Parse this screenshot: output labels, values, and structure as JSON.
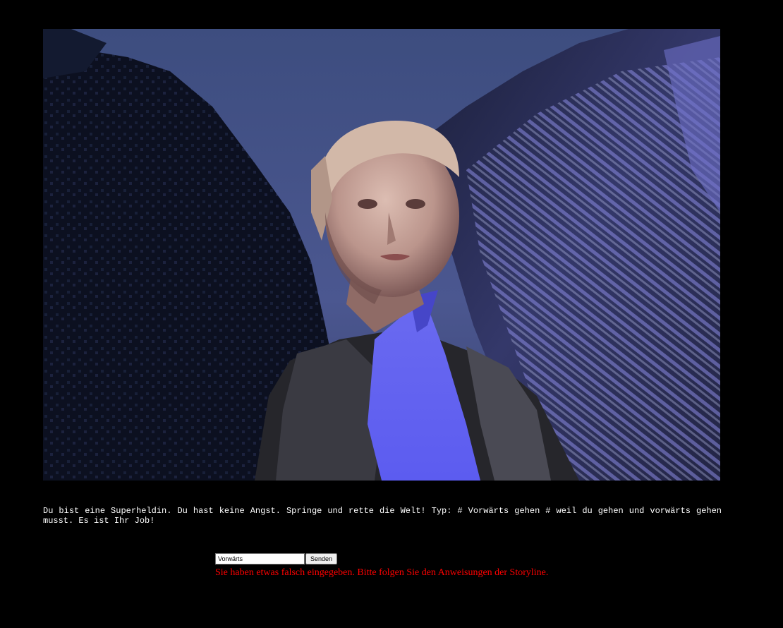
{
  "scene": {
    "image_description_icon": "superheroine-portrait-image",
    "palette": {
      "sky": "#4a5280",
      "foliage": "#0e1220",
      "highlight_blue": "#7474f2",
      "skin": "#c8a79a",
      "hair": "#d8c0b0",
      "jacket": "#2a2a2e"
    }
  },
  "story": {
    "text": "Du bist eine Superheldin. Du hast keine Angst. Springe und rette die Welt! Typ: # Vorwärts gehen # weil du gehen und vorwärts gehen musst. Es ist Ihr Job!"
  },
  "form": {
    "input_value": "Vorwärts",
    "submit_label": "Senden"
  },
  "error": {
    "message": "Sie haben etwas falsch eingegeben. Bitte folgen Sie den Anweisungen der Storyline."
  },
  "colors": {
    "background": "#000000",
    "story_text": "#ffffff",
    "error_text": "#ff0000"
  }
}
